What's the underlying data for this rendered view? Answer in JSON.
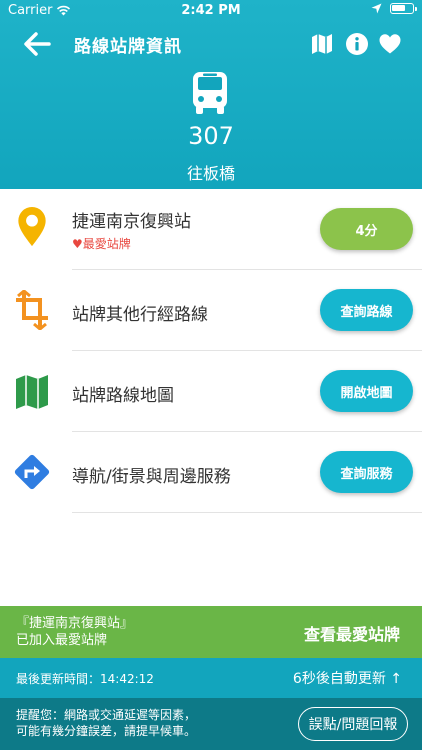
{
  "status_bar": {
    "carrier": "Carrier",
    "time": "2:42 PM"
  },
  "nav": {
    "title": "路線站牌資訊"
  },
  "route": {
    "number": "307",
    "direction": "往板橋"
  },
  "stop": {
    "name": "捷運南京復興站",
    "favorite_note": "♥最愛站牌",
    "eta": "4分"
  },
  "actions": [
    {
      "label": "站牌其他行經路線",
      "button": "查詢路線"
    },
    {
      "label": "站牌路線地圖",
      "button": "開啟地圖"
    },
    {
      "label": "導航/街景與周邊服務",
      "button": "查詢服務"
    }
  ],
  "favorite_bar": {
    "line1": "『捷運南京復興站』",
    "line2": "已加入最愛站牌",
    "link": "查看最愛站牌"
  },
  "update_bar": {
    "last_updated": "最後更新時間：14:42:12",
    "auto_refresh": "6秒後自動更新 ↑"
  },
  "notice": {
    "line1": "提醒您：網路或交通延遲等因素，",
    "line2": "可能有幾分鐘誤差，請提早候車。",
    "report_button": "誤點/問題回報"
  },
  "colors": {
    "header": "#12a5bd",
    "eta_pill": "#8cc34b",
    "action_pill": "#16b6cf",
    "favorite_bar": "#6ab647",
    "notice_bar": "#0d7a88",
    "favorite_text": "#e8473f"
  }
}
